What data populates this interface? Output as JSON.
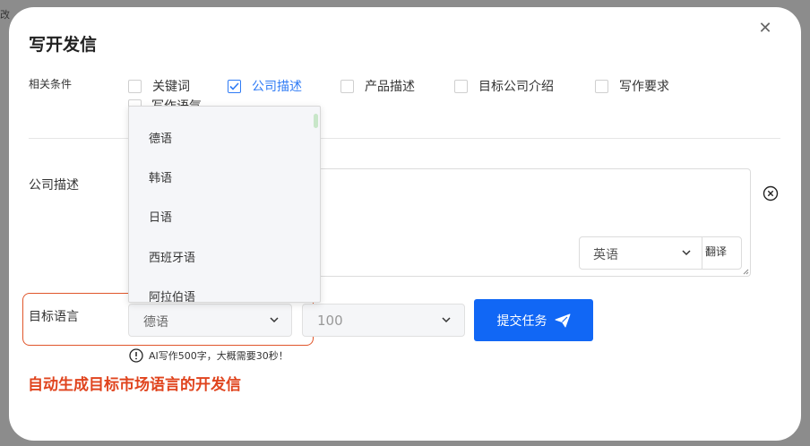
{
  "corner_text": "改",
  "dialog": {
    "title": "写开发信",
    "close_icon": "close-icon"
  },
  "conditions": {
    "label": "相关条件",
    "options": [
      {
        "label": "关键词",
        "checked": false
      },
      {
        "label": "公司描述",
        "checked": true
      },
      {
        "label": "产品描述",
        "checked": false
      },
      {
        "label": "目标公司介绍",
        "checked": false
      },
      {
        "label": "写作要求",
        "checked": false
      }
    ],
    "row2_label": "写作语气"
  },
  "description": {
    "label": "公司描述",
    "language_value": "英语",
    "translate_label": "翻译",
    "clear_icon": "circle-x-icon"
  },
  "target": {
    "label": "目标语言",
    "language_value": "德语",
    "length_value": "100"
  },
  "submit": {
    "label": "提交任务",
    "icon": "paper-plane-icon"
  },
  "info": {
    "icon": "info-icon",
    "text": "AI写作500字，大概需要30秒！"
  },
  "caption": "自动生成目标市场语言的开发信",
  "dropdown": {
    "items": [
      "德语",
      "韩语",
      "日语",
      "西班牙语",
      "阿拉伯语"
    ]
  },
  "colors": {
    "accent": "#1167f5",
    "checked": "#2f7bf5",
    "highlight": "#e0562b",
    "caption": "#e0441e"
  }
}
